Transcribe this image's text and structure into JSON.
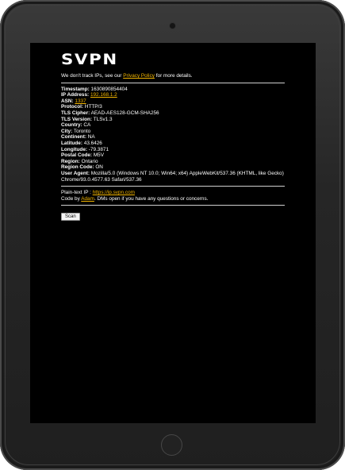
{
  "app": {
    "logo": "SVPN"
  },
  "intro": {
    "prefix": "We don't track IPs, see our ",
    "privacy_link": "Privacy Policy",
    "suffix": " for more details."
  },
  "info": {
    "timestamp_label": "Timestamp:",
    "timestamp": "1630890854404",
    "ip_label": "IP Address:",
    "ip": "192.168.1.2",
    "asn_label": "ASN:",
    "asn": "1337",
    "protocol_label": "Protocol:",
    "protocol": "HTTP/3",
    "cipher_label": "TLS Cipher:",
    "cipher": "AEAD-AES128-GCM-SHA256",
    "tls_label": "TLS Version:",
    "tls": "TLSv1.3",
    "country_label": "Country:",
    "country": "CA",
    "city_label": "City:",
    "city": "Toronto",
    "continent_label": "Continent:",
    "continent": "NA",
    "latitude_label": "Latitude:",
    "latitude": "43.6426",
    "longitude_label": "Longitude:",
    "longitude": "-79.3871",
    "postal_label": "Postal Code:",
    "postal": "M5V",
    "region_label": "Region:",
    "region": "Ontario",
    "region_code_label": "Region Code:",
    "region_code": "ON",
    "ua_label": "User Agent:",
    "ua": "Mozilla/5.0 (Windows NT 10.0; Win64; x64) AppleWebKit/537.36 (KHTML, like Gecko) Chrome/93.0.4577.63 Safari/537.36"
  },
  "footer": {
    "plain_label": "Plain-text IP : ",
    "plain_link": "https://ip.svpn.com",
    "code_prefix": "Code by ",
    "author_link": "Adam",
    "code_suffix": ". DMs open if you have any questions or concerns."
  },
  "actions": {
    "scan_label": "Scan"
  }
}
